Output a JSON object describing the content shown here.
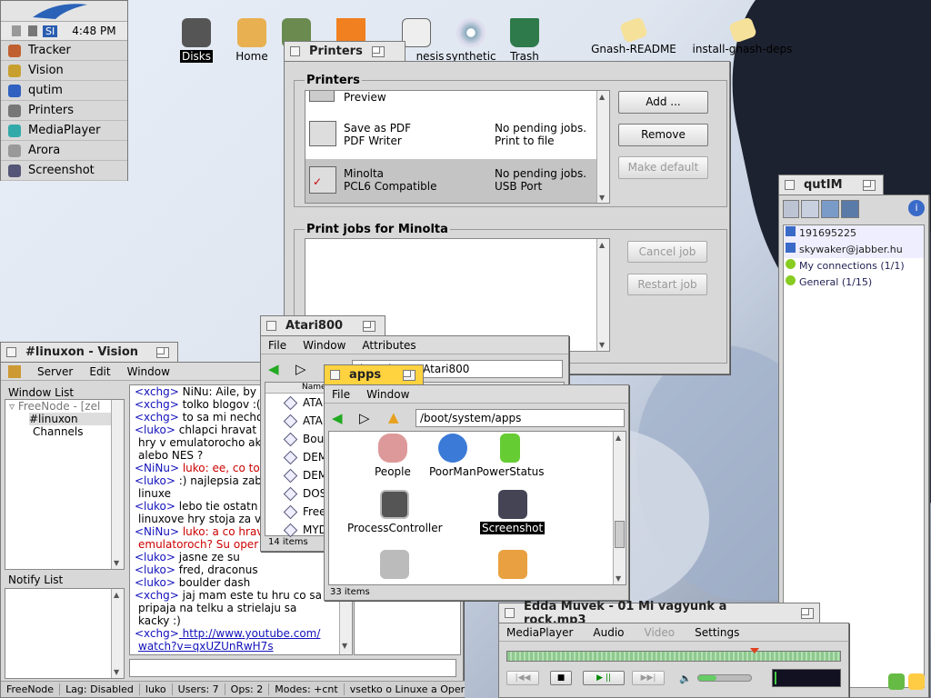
{
  "deskbar": {
    "logo": "Haiku",
    "clock": "4:48 PM",
    "input_indicator": "SI",
    "items": [
      {
        "label": "Tracker",
        "icon": "tracker-icon"
      },
      {
        "label": "Vision",
        "icon": "vision-icon"
      },
      {
        "label": "qutim",
        "icon": "qutim-icon"
      },
      {
        "label": "Printers",
        "icon": "printer-icon"
      },
      {
        "label": "MediaPlayer",
        "icon": "mediaplayer-icon"
      },
      {
        "label": "Arora",
        "icon": "arora-icon"
      },
      {
        "label": "Screenshot",
        "icon": "screenshot-icon"
      }
    ]
  },
  "desktop_icons": [
    {
      "label": "Disks",
      "icon": "disks-icon"
    },
    {
      "label": "Home",
      "icon": "home-folder-icon"
    },
    {
      "label": "nesis",
      "icon": "genesis-icon"
    },
    {
      "label": "synthetic",
      "icon": "cd-icon"
    },
    {
      "label": "Trash",
      "icon": "trash-icon"
    },
    {
      "label": "Gnash-README",
      "icon": "document-icon"
    },
    {
      "label": "install-gnash-deps",
      "icon": "document-icon"
    }
  ],
  "printers": {
    "title": "Printers",
    "group_label": "Printers",
    "list": [
      {
        "name": "Preview",
        "sub": "",
        "status": "",
        "port": ""
      },
      {
        "name": "Save as PDF",
        "sub": "PDF Writer",
        "status": "No pending jobs.",
        "port": "Print to file"
      },
      {
        "name": "Minolta",
        "sub": "PCL6 Compatible",
        "status": "No pending jobs.",
        "port": "USB Port"
      }
    ],
    "add": "Add ...",
    "remove": "Remove",
    "make_default": "Make default",
    "jobs_label": "Print jobs for Minolta",
    "cancel": "Cancel job",
    "restart": "Restart job"
  },
  "qutim": {
    "title": "qutIM",
    "contacts": [
      {
        "label": "191695225"
      },
      {
        "label": "skywaker@jabber.hu"
      }
    ],
    "groups": [
      {
        "label": "My connections (1/1)"
      },
      {
        "label": "General (1/15)"
      }
    ]
  },
  "vision": {
    "title": "#linuxon - Vision",
    "menu": [
      "Server",
      "Edit",
      "Window"
    ],
    "window_list_label": "Window List",
    "tree": [
      "FreeNode - [zel",
      "#linuxon",
      "Channels"
    ],
    "notify_label": "Notify List",
    "chat": [
      {
        "n": "<xchg>",
        "t": " NiNu: Aile, by s",
        "c": ""
      },
      {
        "n": "<xchg>",
        "t": " tolko blogov :(",
        "c": ""
      },
      {
        "n": "<xchg>",
        "t": " to sa mi necho",
        "c": ""
      },
      {
        "n": "<luko>",
        "t": " chlapci  hravat",
        "c": ""
      },
      {
        "n": "",
        "t": "hry v emulatorocho ak",
        "c": ""
      },
      {
        "n": "",
        "t": "alebo NES ?",
        "c": ""
      },
      {
        "n": "<NiNu>",
        "t": " luko: ee, co to",
        "c": "red"
      },
      {
        "n": "<luko>",
        "t": " :) najlepsia zab",
        "c": ""
      },
      {
        "n": "",
        "t": "linuxe",
        "c": ""
      },
      {
        "n": "<luko>",
        "t": " lebo tie ostatn",
        "c": ""
      },
      {
        "n": "",
        "t": "linuxove hry stoja za v",
        "c": ""
      },
      {
        "n": "<NiNu>",
        "t": " luko: a co hrav",
        "c": "red"
      },
      {
        "n": "",
        "t": "emulatoroch? Su oper",
        "c": "red"
      },
      {
        "n": "<luko>",
        "t": " jasne ze su",
        "c": ""
      },
      {
        "n": "<luko>",
        "t": " fred, draconus",
        "c": ""
      },
      {
        "n": "<luko>",
        "t": " boulder dash",
        "c": ""
      },
      {
        "n": "<xchg>",
        "t": " jaj mam este tu hru co sa",
        "c": ""
      },
      {
        "n": "",
        "t": "pripaja na telku a strielaju sa",
        "c": ""
      },
      {
        "n": "",
        "t": "kacky :)",
        "c": ""
      },
      {
        "n": "<xchg>",
        "t": " http://www.youtube.com/",
        "c": "link"
      },
      {
        "n": "",
        "t": "watch?v=qxUZUnRwH7s",
        "c": "link"
      }
    ],
    "status": [
      "FreeNode",
      "Lag: Disabled",
      "luko",
      "Users: 7",
      "Ops: 2",
      "Modes: +cnt",
      "vsetko o Linuxe a OpenSo"
    ]
  },
  "atari": {
    "title": "Atari800",
    "menu": [
      "File",
      "Window",
      "Attributes"
    ],
    "path": "/boot/home/Atari800",
    "col": "Name",
    "items": [
      "ATA",
      "ATA",
      "Bou",
      "DEM",
      "DEM",
      "DOS",
      "Free",
      "MYD"
    ],
    "count": "14 items"
  },
  "apps": {
    "title": "apps",
    "menu": [
      "File",
      "Window"
    ],
    "path": "/boot/system/apps",
    "icons": [
      {
        "label": "People",
        "icon": "people-icon"
      },
      {
        "label": "PoorMan",
        "icon": "poorman-icon"
      },
      {
        "label": "PowerStatus",
        "icon": "battery-icon"
      },
      {
        "label": "ProcessController",
        "icon": "process-controller-icon"
      },
      {
        "label": "Screenshot",
        "icon": "screenshot-icon"
      },
      {
        "label": "",
        "icon": "projector-icon"
      },
      {
        "label": "",
        "icon": "sound-recorder-icon"
      }
    ],
    "count": "33 items"
  },
  "media": {
    "title": "Edda Muvek - 01 Mi vagyunk a rock.mp3",
    "menu": [
      "MediaPlayer",
      "Audio",
      "Video",
      "Settings"
    ],
    "progress": 0.73,
    "volume": 0.35
  }
}
